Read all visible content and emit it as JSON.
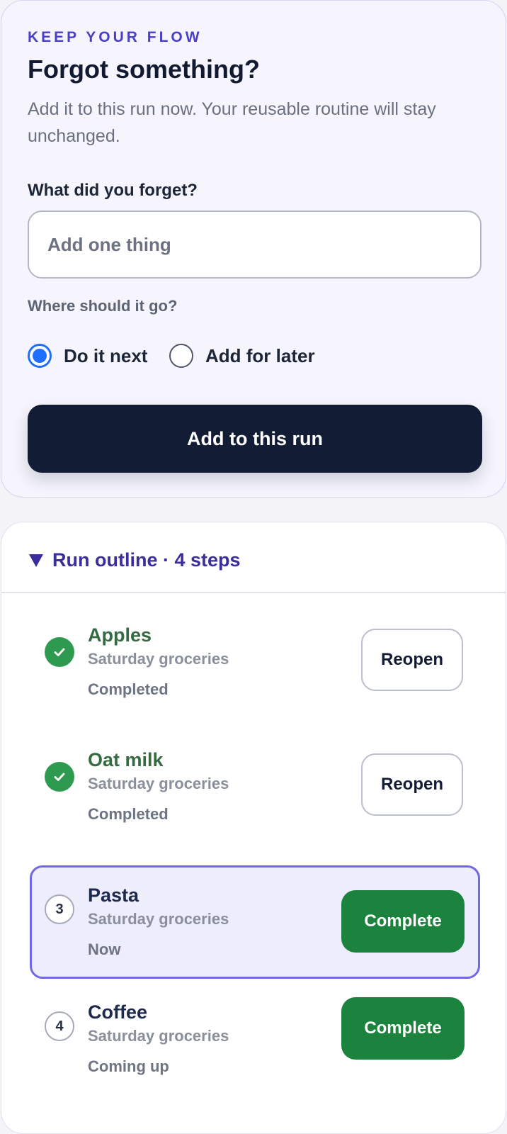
{
  "capture": {
    "eyebrow": "KEEP YOUR FLOW",
    "title": "Forgot something?",
    "subtitle": "Add it to this run now. Your reusable routine will stay unchanged.",
    "field_label": "What did you forget?",
    "input_placeholder": "Add one thing",
    "input_value": "",
    "placement_label": "Where should it go?",
    "options": [
      {
        "label": "Do it next",
        "selected": true
      },
      {
        "label": "Add for later",
        "selected": false
      }
    ],
    "submit_label": "Add to this run"
  },
  "outline": {
    "summary": "Run outline · 4 steps",
    "expanded": true,
    "steps": [
      {
        "number": "1",
        "name": "Apples",
        "routine": "Saturday groceries",
        "status": "Completed",
        "done": true,
        "action": "Reopen"
      },
      {
        "number": "2",
        "name": "Oat milk",
        "routine": "Saturday groceries",
        "status": "Completed",
        "done": true,
        "action": "Reopen"
      },
      {
        "number": "3",
        "name": "Pasta",
        "routine": "Saturday groceries",
        "status": "Now",
        "done": false,
        "current": true,
        "action": "Complete"
      },
      {
        "number": "4",
        "name": "Coffee",
        "routine": "Saturday groceries",
        "status": "Coming up",
        "done": false,
        "action": "Complete"
      }
    ]
  },
  "colors": {
    "accent": "#4a3fc7",
    "primary_button": "#121c34",
    "radio_selected": "#1f6fff",
    "done_check": "#2e9a4f",
    "complete_button": "#1b833d",
    "current_highlight": "#7267e4"
  },
  "icons": {
    "done": "check-icon",
    "summary": "triangle-down-icon"
  }
}
